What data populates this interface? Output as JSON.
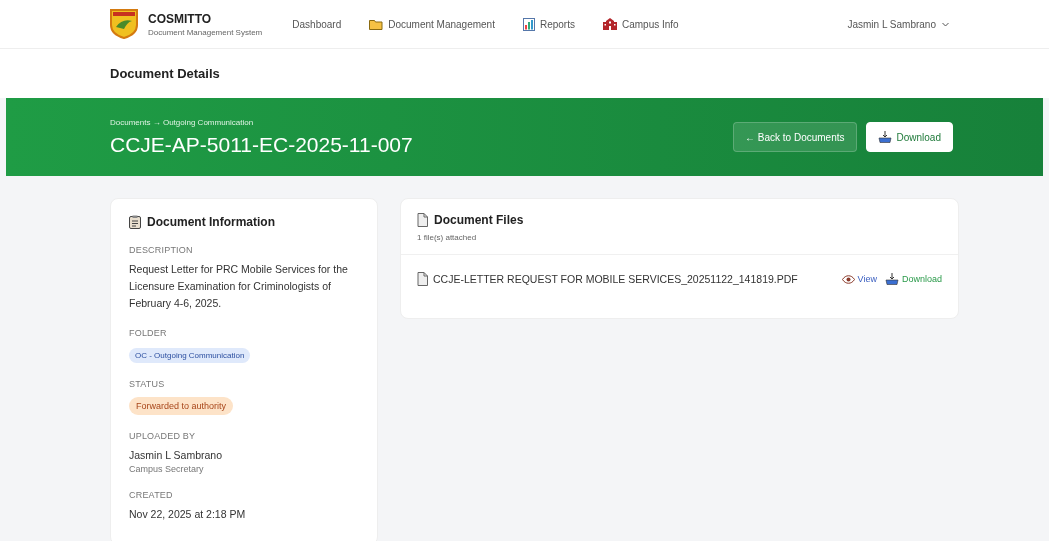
{
  "header": {
    "brand": "COSMITTO",
    "subtitle": "Document Management System",
    "nav": [
      {
        "label": "Dashboard"
      },
      {
        "label": "Document Management"
      },
      {
        "label": "Reports"
      },
      {
        "label": "Campus Info"
      }
    ],
    "user": "Jasmin L Sambrano"
  },
  "page_title": "Document Details",
  "hero": {
    "breadcrumb": "Documents → Outgoing Communication",
    "title": "CCJE-AP-5011-EC-2025-11-007",
    "buttons": [
      {
        "label": "← Back to Documents",
        "kind": "ghost"
      },
      {
        "label": "Download",
        "kind": "primary"
      }
    ]
  },
  "info": {
    "title": "Document Information",
    "fields": [
      {
        "label": "DESCRIPTION",
        "kind": "text",
        "value": "Request Letter for PRC Mobile Services for the Licensure Examination for Criminologists of February 4-6, 2025."
      },
      {
        "label": "FOLDER",
        "kind": "folder-tag",
        "value": "OC - Outgoing Communication"
      },
      {
        "label": "STATUS",
        "kind": "status-tag",
        "value": "Forwarded to authority"
      },
      {
        "label": "UPLOADED BY",
        "kind": "person",
        "value": "Jasmin L Sambrano",
        "role": "Campus Secretary"
      },
      {
        "label": "CREATED",
        "kind": "text",
        "value": "Nov 22, 2025 at 2:18 PM"
      }
    ]
  },
  "files": {
    "title": "Document Files",
    "count": "1 file(s) attached",
    "items": [
      {
        "name": "CCJE-LETTER REQUEST FOR MOBILE SERVICES_20251122_141819.PDF",
        "view": "View",
        "download": "Download"
      }
    ]
  }
}
